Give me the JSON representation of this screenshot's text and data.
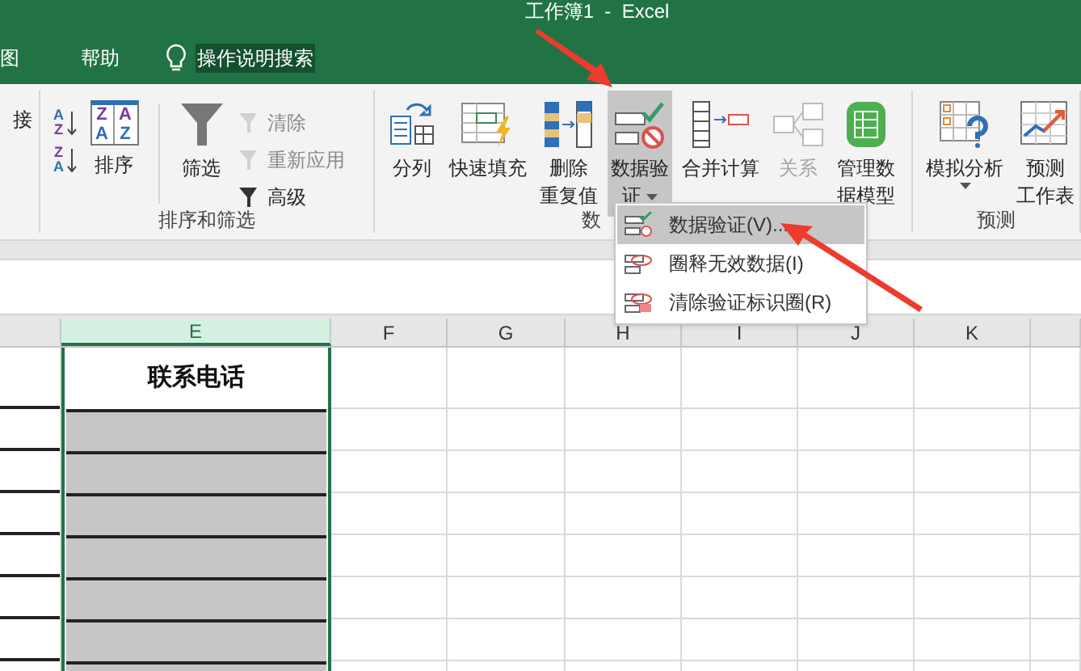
{
  "window": {
    "title": "工作簿1  -  Excel"
  },
  "tabs": [
    {
      "label": "图",
      "selected": false
    },
    {
      "label": "帮助",
      "selected": false
    }
  ],
  "tell_me": {
    "label": "操作说明搜索"
  },
  "ribbon": {
    "groups": [
      {
        "buttons": [
          {
            "kind": "big",
            "lines": [
              "接"
            ],
            "disabled": false,
            "selected": false,
            "dropdown": false
          }
        ]
      },
      {
        "label": "排序和筛选",
        "buttons": [
          {
            "kind": "small",
            "glyphs": [
              "A",
              "Z"
            ],
            "disabled": false
          },
          {
            "kind": "small",
            "glyphs": [
              "Z",
              "A"
            ],
            "disabled": false
          },
          {
            "kind": "big",
            "glyphs": [
              "Z",
              "A",
              "A",
              "Z"
            ],
            "lines": [
              "排序"
            ],
            "disabled": false,
            "selected": false,
            "dropdown": false
          },
          {
            "kind": "separator"
          },
          {
            "kind": "big",
            "lines": [
              "筛选"
            ],
            "disabled": false,
            "selected": false,
            "dropdown": false
          },
          {
            "kind": "small",
            "label": "清除",
            "disabled": true
          },
          {
            "kind": "small",
            "label": "重新应用",
            "disabled": true
          },
          {
            "kind": "small",
            "label": "高级",
            "disabled": false
          }
        ]
      },
      {
        "label": "数",
        "buttons": [
          {
            "kind": "big",
            "lines": [
              "分列"
            ],
            "disabled": false,
            "selected": false,
            "dropdown": false
          },
          {
            "kind": "big",
            "lines": [
              "快速填充"
            ],
            "disabled": false,
            "selected": false,
            "dropdown": false
          },
          {
            "kind": "big",
            "lines": [
              "删除",
              "重复值"
            ],
            "disabled": false,
            "selected": false,
            "dropdown": false
          },
          {
            "kind": "big",
            "lines": [
              "数据验",
              "证"
            ],
            "disabled": false,
            "selected": true,
            "dropdown": true
          },
          {
            "kind": "big",
            "lines": [
              "合并计算"
            ],
            "disabled": false,
            "selected": false,
            "dropdown": false
          },
          {
            "kind": "big",
            "lines": [
              "关系"
            ],
            "disabled": true,
            "selected": false,
            "dropdown": false
          },
          {
            "kind": "big",
            "lines": [
              "管理数",
              "据模型"
            ],
            "disabled": false,
            "selected": false,
            "dropdown": false
          }
        ]
      },
      {
        "label": "预测",
        "buttons": [
          {
            "kind": "big",
            "lines": [
              "模拟分析"
            ],
            "disabled": false,
            "selected": false,
            "dropdown": true
          },
          {
            "kind": "big",
            "lines": [
              "预测",
              "工作表"
            ],
            "disabled": false,
            "selected": false,
            "dropdown": false
          }
        ]
      }
    ]
  },
  "menu": {
    "items": [
      {
        "label": "数据验证(V)...",
        "selected": true
      },
      {
        "label": "圈释无效数据(I)",
        "selected": false
      },
      {
        "label": "清除验证标识圈(R)",
        "selected": false
      }
    ]
  },
  "sheet": {
    "columns": [
      {
        "selected": false
      },
      {
        "label": "E",
        "selected": true
      },
      {
        "label": "F",
        "selected": false
      },
      {
        "label": "G",
        "selected": false
      },
      {
        "label": "H",
        "selected": false
      },
      {
        "label": "I",
        "selected": false
      },
      {
        "label": "J",
        "selected": false
      },
      {
        "label": "K",
        "selected": false
      },
      {
        "selected": false
      }
    ],
    "header_cell": "联系电话"
  }
}
